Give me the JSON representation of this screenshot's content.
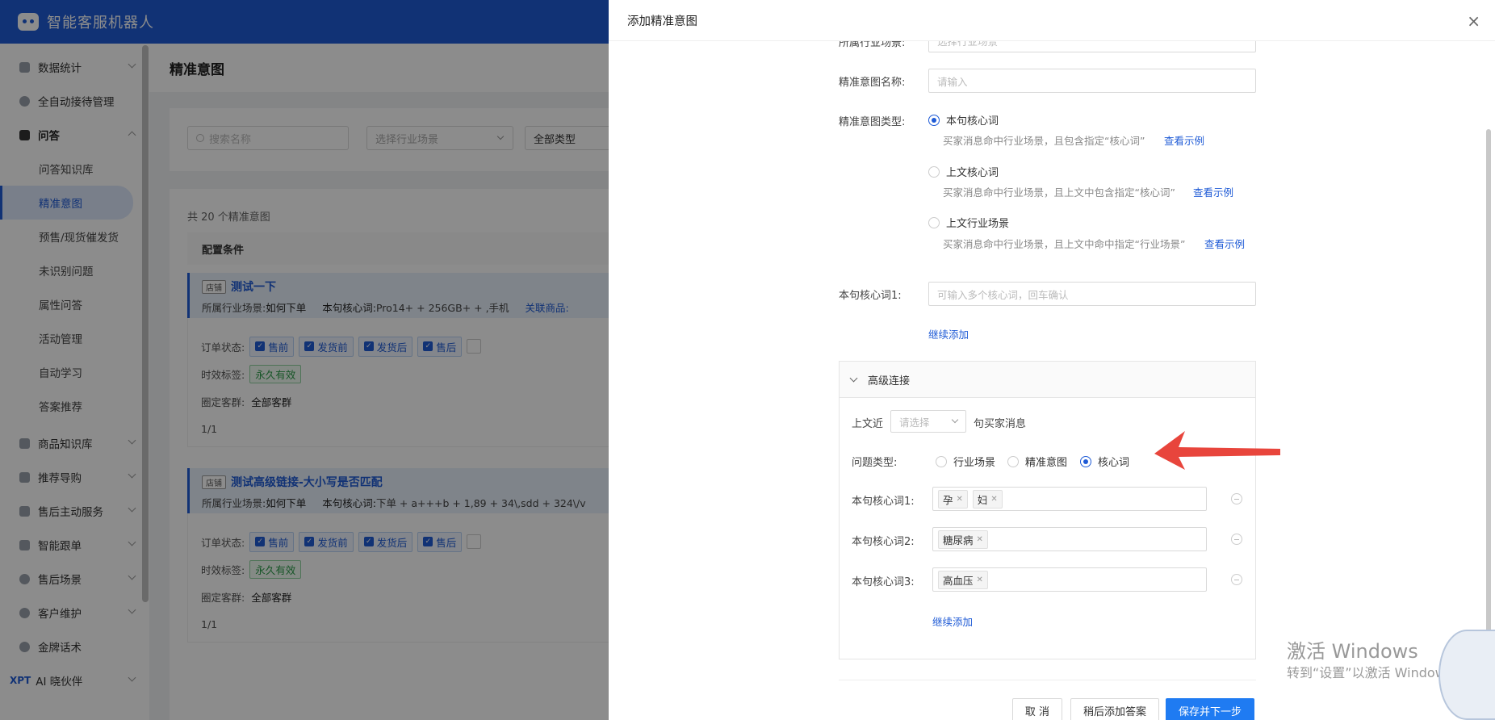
{
  "app": {
    "title": "智能客服机器人"
  },
  "sidebar": {
    "items": [
      {
        "label": "数据统计"
      },
      {
        "label": "全自动接待管理"
      },
      {
        "label": "问答"
      },
      {
        "label": "问答知识库"
      },
      {
        "label": "精准意图"
      },
      {
        "label": "预售/现货催发货"
      },
      {
        "label": "未识别问题"
      },
      {
        "label": "属性问答"
      },
      {
        "label": "活动管理"
      },
      {
        "label": "自动学习"
      },
      {
        "label": "答案推荐"
      },
      {
        "label": "商品知识库"
      },
      {
        "label": "推荐导购"
      },
      {
        "label": "售后主动服务"
      },
      {
        "label": "智能跟单"
      },
      {
        "label": "售后场景"
      },
      {
        "label": "客户维护"
      },
      {
        "label": "金牌话术"
      },
      {
        "label": "AI 晓伙伴",
        "prefix": "XPT"
      }
    ]
  },
  "main": {
    "title": "精准意图",
    "filter": {
      "search_placeholder": "搜索名称",
      "industry_placeholder": "选择行业场景",
      "type_value": "全部类型"
    },
    "total": "共 20 个精准意图",
    "table_header": "配置条件",
    "cards": [
      {
        "badge": "店铺",
        "title": "测试一下",
        "industry_label": "所属行业场景:",
        "industry_value": "如何下单",
        "kw_label": "本句核心词:",
        "kw_value": "Pro14+ + 256GB+ + ,手机",
        "rel": "关联商品:",
        "order_label": "订单状态:",
        "states": [
          "售前",
          "发货前",
          "发货后",
          "售后"
        ],
        "time_label": "时效标签:",
        "time_value": "永久有效",
        "group_label": "圈定客群:",
        "group_value": "全部客群",
        "page": "1/1"
      },
      {
        "badge": "店铺",
        "title": "测试高级链接-大小写是否匹配",
        "industry_label": "所属行业场景:",
        "industry_value": "如何下单",
        "kw_label": "本句核心词:",
        "kw_value": "下单 + a+++b + 1,89 + 34\\,sdd + 324\\/v",
        "rel": "",
        "order_label": "订单状态:",
        "states": [
          "售前",
          "发货前",
          "发货后",
          "售后"
        ],
        "time_label": "时效标签:",
        "time_value": "永久有效",
        "group_label": "圈定客群:",
        "group_value": "全部客群",
        "page": "1/1"
      }
    ]
  },
  "drawer": {
    "title": "添加精准意图",
    "close": "×",
    "industry_label": "所属行业场景:",
    "industry_placeholder": "选择行业场景",
    "name_label": "精准意图名称:",
    "name_placeholder": "请输入",
    "type_label": "精准意图类型:",
    "type_options": [
      {
        "label": "本句核心词",
        "desc": "买家消息命中行业场景，且包含指定“核心词”",
        "link": "查看示例",
        "checked": true
      },
      {
        "label": "上文核心词",
        "desc": "买家消息命中行业场景，且上文中包含指定“核心词”",
        "link": "查看示例",
        "checked": false
      },
      {
        "label": "上文行业场景",
        "desc": "买家消息命中行业场景，且上文中命中指定“行业场景”",
        "link": "查看示例",
        "checked": false
      }
    ],
    "kw1_label": "本句核心词1:",
    "kw1_placeholder": "可输入多个核心词，回车确认",
    "continue_add": "继续添加",
    "advanced": {
      "title": "高级连接",
      "prev_label": "上文近",
      "prev_placeholder": "请选择",
      "prev_suffix": "句买家消息",
      "qtype_label": "问题类型:",
      "qtype_options": [
        {
          "label": "行业场景",
          "checked": false
        },
        {
          "label": "精准意图",
          "checked": false
        },
        {
          "label": "核心词",
          "checked": true
        }
      ],
      "keywords": [
        {
          "label": "本句核心词1:",
          "tags": [
            "孕",
            "妇"
          ]
        },
        {
          "label": "本句核心词2:",
          "tags": [
            "糖尿病"
          ]
        },
        {
          "label": "本句核心词3:",
          "tags": [
            "高血压"
          ]
        }
      ],
      "continue_add": "继续添加"
    },
    "buttons": {
      "cancel": "取 消",
      "later": "稍后添加答案",
      "save": "保存并下一步"
    }
  },
  "watermark": {
    "line1": "激活 Windows",
    "line2": "转到“设置”以激活 Windows。"
  },
  "colors": {
    "brand": "#1f5bd6",
    "primary_button": "#1f7bf2",
    "annotation_arrow": "#e8453c"
  }
}
